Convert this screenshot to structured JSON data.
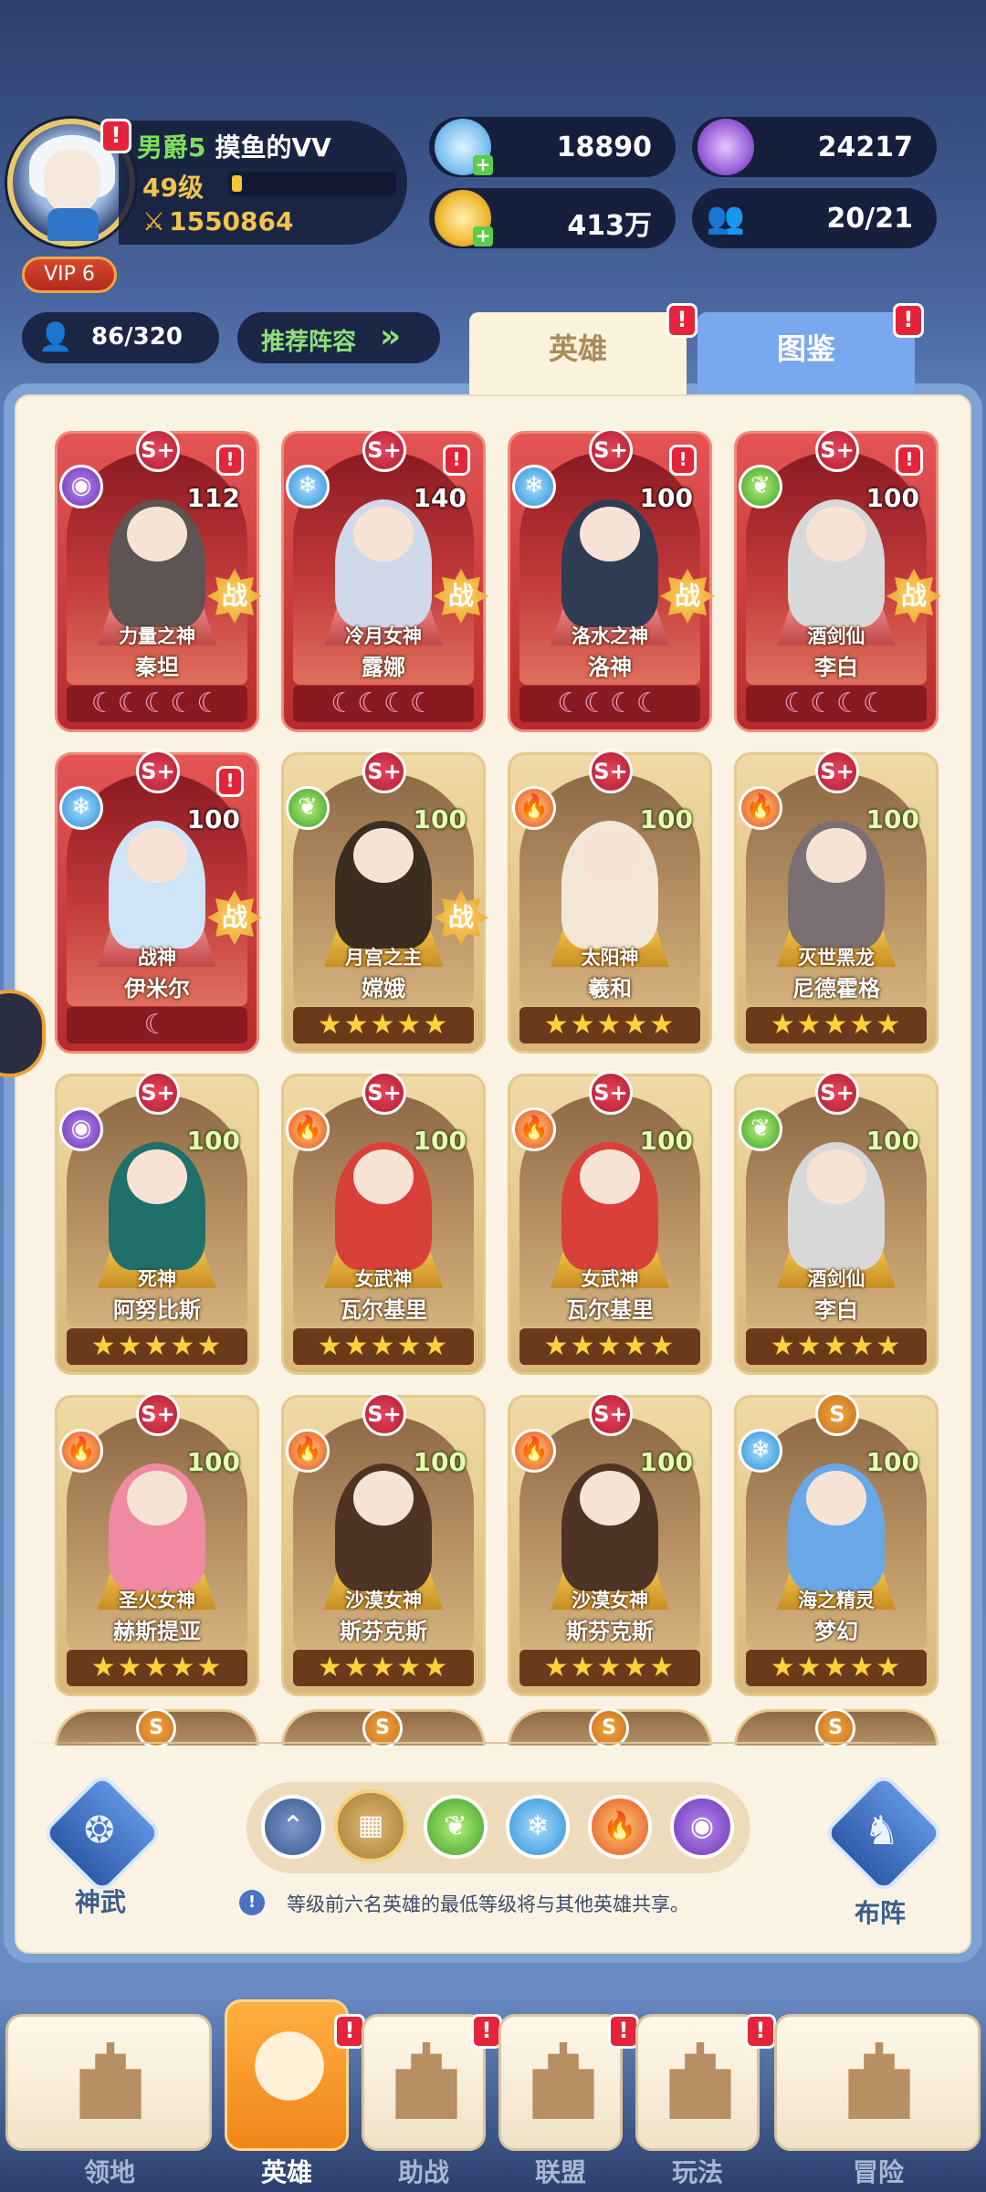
{
  "player": {
    "rank": "男爵5",
    "nickname": "摸鱼的VV",
    "level": "49级",
    "level_progress": 0.06,
    "power": "1550864",
    "vip": "VIP 6",
    "alert": "!"
  },
  "resources": {
    "crystal": "18890",
    "orb": "24217",
    "gold": "413万",
    "team": "20/21"
  },
  "hero_count": "86/320",
  "recommend_label": "推荐阵容",
  "tabs": [
    {
      "label": "英雄",
      "alert": "!"
    },
    {
      "label": "图鉴",
      "alert": "!"
    }
  ],
  "heroes": [
    {
      "title": "力量之神",
      "name": "秦坦",
      "level": "112",
      "grade": "S+",
      "element": "dark",
      "moons": "☾☾☾☾☾",
      "battle": "战",
      "alert": "!"
    },
    {
      "title": "冷月女神",
      "name": "露娜",
      "level": "140",
      "grade": "S+",
      "element": "ice",
      "moons": "☾☾☾☾",
      "battle": "战",
      "alert": "!"
    },
    {
      "title": "洛水之神",
      "name": "洛神",
      "level": "100",
      "grade": "S+",
      "element": "ice",
      "moons": "☾☾☾☾",
      "battle": "战",
      "alert": "!"
    },
    {
      "title": "酒剑仙",
      "name": "李白",
      "level": "100",
      "grade": "S+",
      "element": "nature",
      "moons": "☾☾☾☾",
      "battle": "战",
      "alert": "!"
    },
    {
      "title": "战神",
      "name": "伊米尔",
      "level": "100",
      "grade": "S+",
      "element": "ice",
      "moons": "☾",
      "battle": "战",
      "alert": "!"
    },
    {
      "title": "月宫之主",
      "name": "嫦娥",
      "level": "100",
      "grade": "S+",
      "element": "nature",
      "stars": "★★★★★",
      "battle": "战"
    },
    {
      "title": "太阳神",
      "name": "羲和",
      "level": "100",
      "grade": "S+",
      "element": "fire",
      "stars": "★★★★★"
    },
    {
      "title": "灭世黑龙",
      "name": "尼德霍格",
      "level": "100",
      "grade": "S+",
      "element": "fire",
      "stars": "★★★★★"
    },
    {
      "title": "死神",
      "name": "阿努比斯",
      "level": "100",
      "grade": "S+",
      "element": "dark",
      "stars": "★★★★★"
    },
    {
      "title": "女武神",
      "name": "瓦尔基里",
      "level": "100",
      "grade": "S+",
      "element": "fire",
      "stars": "★★★★★"
    },
    {
      "title": "女武神",
      "name": "瓦尔基里",
      "level": "100",
      "grade": "S+",
      "element": "fire",
      "stars": "★★★★★"
    },
    {
      "title": "酒剑仙",
      "name": "李白",
      "level": "100",
      "grade": "S+",
      "element": "nature",
      "stars": "★★★★★"
    },
    {
      "title": "圣火女神",
      "name": "赫斯提亚",
      "level": "100",
      "grade": "S+",
      "element": "fire",
      "stars": "★★★★★"
    },
    {
      "title": "沙漠女神",
      "name": "斯芬克斯",
      "level": "100",
      "grade": "S+",
      "element": "fire",
      "stars": "★★★★★"
    },
    {
      "title": "沙漠女神",
      "name": "斯芬克斯",
      "level": "100",
      "grade": "S+",
      "element": "fire",
      "stars": "★★★★★"
    },
    {
      "title": "海之精灵",
      "name": "梦幻",
      "level": "100",
      "grade": "S",
      "element": "ice",
      "stars": "★★★★★"
    }
  ],
  "partial_grades": [
    "S",
    "S",
    "S",
    "S"
  ],
  "bottom_panel": {
    "divine_weapon": "神武",
    "formation": "布阵",
    "hint": "等级前六名英雄的最低等级将与其他英雄共享。",
    "filters": [
      "up",
      "all",
      "nature",
      "ice",
      "fire",
      "dark"
    ]
  },
  "nav": [
    {
      "label": "领地"
    },
    {
      "label": "英雄",
      "alert": "!"
    },
    {
      "label": "助战",
      "alert": "!"
    },
    {
      "label": "联盟",
      "alert": "!"
    },
    {
      "label": "玩法",
      "alert": "!"
    },
    {
      "label": "冒险"
    }
  ],
  "colors": {
    "accent": "#f08418",
    "alert": "#e3243a",
    "panel": "#faf3e3",
    "gold": "#f2c44b"
  }
}
